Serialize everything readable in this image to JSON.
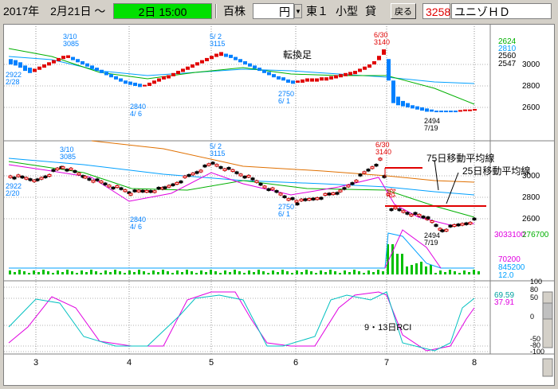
{
  "toolbar": {
    "date": "2017年　2月21日 ～",
    "time": "2日 15:00",
    "unit1": "百株",
    "unit2": "円",
    "market": "東１",
    "type": "小型",
    "loan": "貸",
    "back_label": "戻る",
    "code": "3258",
    "name": "ユニゾＨＤ"
  },
  "chart": {
    "title_top": "転換足",
    "price_ticks": [
      "3000",
      "2800",
      "2600"
    ],
    "lower_ticks": [
      "3000",
      "2800",
      "2600"
    ],
    "top_right_values": [
      "2624",
      "2810",
      "2560",
      "2547"
    ],
    "legend_75": "75日移動平均線",
    "legend_25": "25日移動平均線",
    "window_mark": "窓",
    "volume_left": "3033100",
    "volume_right": "276700",
    "vol_values": [
      "70200",
      "845200",
      "12.0"
    ],
    "rci_title": "9・13日RCI",
    "rci_ticks": [
      "100",
      "80",
      "50",
      "0",
      "-50",
      "-80",
      "-100"
    ],
    "rci_values": [
      "69.59",
      "37.91"
    ],
    "x_labels": [
      "3",
      "4",
      "5",
      "6",
      "7",
      "8"
    ],
    "annotations_top": [
      {
        "lines": [
          "3/10",
          "3085"
        ]
      },
      {
        "lines": [
          "5/ 2",
          "3115"
        ]
      },
      {
        "lines": [
          "6/30",
          "3140"
        ]
      },
      {
        "lines": [
          "2922",
          "2/28"
        ]
      },
      {
        "lines": [
          "2840",
          "4/ 6"
        ]
      },
      {
        "lines": [
          "2750",
          "6/ 1"
        ]
      },
      {
        "lines": [
          "2494",
          "7/19"
        ]
      }
    ],
    "annotations_mid": [
      {
        "lines": [
          "3/10",
          "3085"
        ]
      },
      {
        "lines": [
          "5/ 2",
          "3115"
        ]
      },
      {
        "lines": [
          "6/30",
          "3140"
        ]
      },
      {
        "lines": [
          "2922",
          "2/20"
        ]
      },
      {
        "lines": [
          "2840",
          "4/ 6"
        ]
      },
      {
        "lines": [
          "2750",
          "6/ 1"
        ]
      },
      {
        "lines": [
          "2494",
          "7/19"
        ]
      }
    ]
  },
  "colors": {
    "up": "#e00000",
    "down": "#0080ff",
    "ma_green": "#00b000",
    "ma_blue": "#00a0ff",
    "ma_orange": "#e07000",
    "rci_magenta": "#e000e0",
    "rci_cyan": "#00c0c0",
    "volume": "#00c000"
  }
}
